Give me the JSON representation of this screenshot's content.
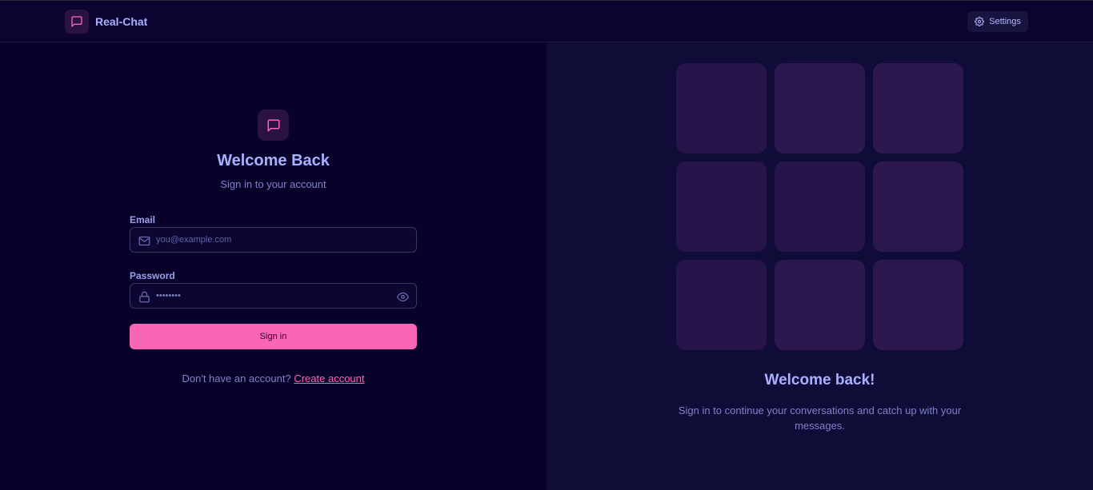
{
  "app": {
    "name": "Real-Chat"
  },
  "header": {
    "settings_label": "Settings"
  },
  "login": {
    "title": "Welcome Back",
    "subtitle": "Sign in to your account",
    "email_label": "Email",
    "email_placeholder": "you@example.com",
    "email_value": "",
    "password_label": "Password",
    "password_value": "••••••••",
    "submit_label": "Sign in",
    "signup_prompt": "Don't have an account?",
    "signup_link": "Create account"
  },
  "promo": {
    "title": "Welcome back!",
    "text": "Sign in to continue your conversations and catch up with your messages."
  },
  "colors": {
    "accent": "#f966b5",
    "heading": "#a9b0ff",
    "background": "#08022a",
    "panel": "#100c38"
  }
}
